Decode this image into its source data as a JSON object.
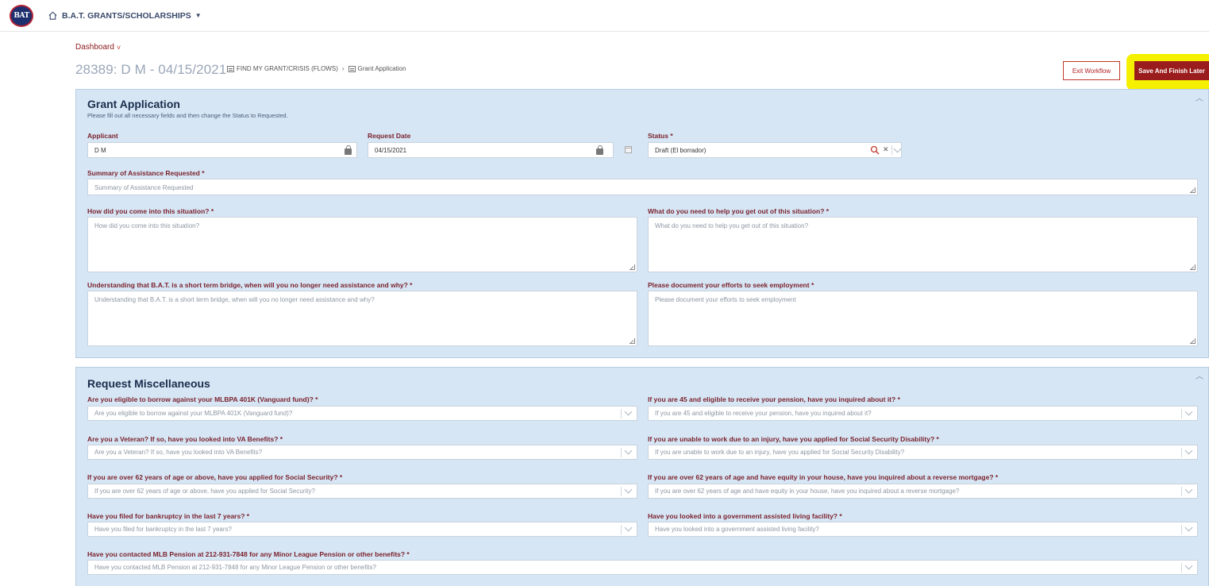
{
  "header": {
    "logo_text": "BAT",
    "app_name": "B.A.T. GRANTS/SCHOLARSHIPS",
    "app_caret": "▼"
  },
  "dashboard": {
    "label": "Dashboard",
    "chevron": "˅"
  },
  "record": {
    "title": "28389: D M - 04/15/2021",
    "breadcrumb_1": "FIND MY GRANT/CRISIS (FLOWS)",
    "breadcrumb_sep": "›",
    "breadcrumb_2": "Grant Application"
  },
  "actions": {
    "exit_label": "Exit Workflow",
    "save_label": "Save And Finish Later"
  },
  "grant_application": {
    "title": "Grant Application",
    "subtitle": "Please fill out all necessary fields and then change the Status to Requested.",
    "applicant_label": "Applicant",
    "applicant_value": "D M",
    "request_date_label": "Request Date",
    "request_date_value": "04/15/2021",
    "status_label": "Status *",
    "status_value": "Draft (El borrador)",
    "summary_label": "Summary of Assistance Requested *",
    "summary_placeholder": "Summary of Assistance Requested",
    "situation_label": "How did you come into this situation? *",
    "situation_placeholder": "How did you come into this situation?",
    "need_label": "What do you need to help you get out of this situation? *",
    "need_placeholder": "What do you need to help you get out of this situation?",
    "bridge_label": "Understanding that B.A.T. is a short term bridge, when will you no longer need assistance and why? *",
    "bridge_placeholder": "Understanding that B.A.T. is a short term bridge, when will you no longer need assistance and why?",
    "employment_label": "Please document your efforts to seek employment *",
    "employment_placeholder": "Please document your efforts to seek employment"
  },
  "misc": {
    "title": "Request Miscellaneous",
    "q401k_label": "Are you eligible to borrow against your MLBPA 401K (Vanguard fund)? *",
    "q401k_placeholder": "Are you eligible to borrow against your MLBPA 401K (Vanguard fund)?",
    "pension_label": "If you are 45 and eligible to receive your pension, have you inquired about it? *",
    "pension_placeholder": "If you are 45 and eligible to receive your pension, have you inquired about it?",
    "veteran_label": "Are you a Veteran? If so, have you looked into VA Benefits? *",
    "veteran_placeholder": "Are you a Veteran? If so, have you looked into VA Benefits?",
    "disability_label": "If you are unable to work due to an injury, have you applied for Social Security Disability? *",
    "disability_placeholder": "If you are unable to work due to an injury, have you applied for Social Security Disability?",
    "social_label": "If you are over 62 years of age or above, have you applied for Social Security? *",
    "social_placeholder": "If you are over 62 years of age or above, have you applied for Social Security?",
    "mortgage_label": "If you are over 62 years of age and have equity in your house, have you inquired about a reverse mortgage? *",
    "mortgage_placeholder": "If you are over 62 years of age and have equity in your house, have you inquired about a reverse mortgage?",
    "bankruptcy_label": "Have you filed for bankruptcy in the last 7 years? *",
    "bankruptcy_placeholder": "Have you filed for bankruptcy in the last 7 years?",
    "living_label": "Have you looked into a government assisted living facility? *",
    "living_placeholder": "Have you looked into a government assisted living facility?",
    "mlb_label": "Have you contacted MLB Pension at 212-931-7848 for any Minor League Pension or other benefits? *",
    "mlb_placeholder": "Have you contacted MLB Pension at 212-931-7848 for any Minor League Pension or other benefits?"
  },
  "colors": {
    "accent": "#9b1c1c",
    "panel_bg": "#d6e6f4",
    "highlight": "#f4f000",
    "label": "#7a1f2b"
  }
}
